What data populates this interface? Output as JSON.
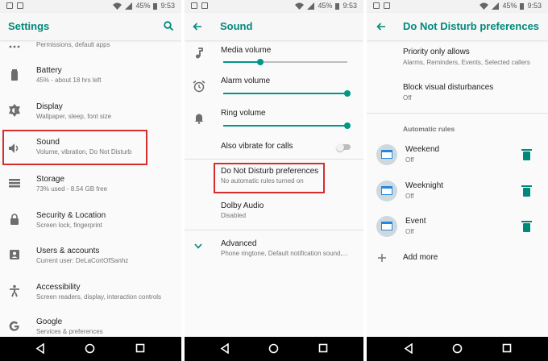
{
  "status": {
    "battery": "45%",
    "time": "9:53"
  },
  "settings": {
    "title": "Settings",
    "partial_top": "Permissions, default apps",
    "items": [
      {
        "title": "Battery",
        "subtitle": "45% - about 18 hrs left",
        "icon": "battery-icon"
      },
      {
        "title": "Display",
        "subtitle": "Wallpaper, sleep, font size",
        "icon": "brightness-icon"
      },
      {
        "title": "Sound",
        "subtitle": "Volume, vibration, Do Not Disturb",
        "icon": "volume-icon"
      },
      {
        "title": "Storage",
        "subtitle": "73% used - 8.54 GB free",
        "icon": "storage-icon"
      },
      {
        "title": "Security & Location",
        "subtitle": "Screen lock, fingerprint",
        "icon": "lock-icon"
      },
      {
        "title": "Users & accounts",
        "subtitle": "Current user: DeLaCortOfSanhz",
        "icon": "account-icon"
      },
      {
        "title": "Accessibility",
        "subtitle": "Screen readers, display, interaction controls",
        "icon": "accessibility-icon"
      },
      {
        "title": "Google",
        "subtitle": "Services & preferences",
        "icon": "google-icon"
      }
    ]
  },
  "sound": {
    "title": "Sound",
    "media_volume": "Media volume",
    "media_level": 0.3,
    "alarm_volume": "Alarm volume",
    "alarm_level": 1.0,
    "ring_volume": "Ring volume",
    "ring_level": 1.0,
    "vibrate": "Also vibrate for calls",
    "dnd_title": "Do Not Disturb preferences",
    "dnd_subtitle": "No automatic rules turned on",
    "dolby_title": "Dolby Audio",
    "dolby_subtitle": "Disabled",
    "advanced_title": "Advanced",
    "advanced_subtitle": "Phone ringtone, Default notification sound,..."
  },
  "dnd": {
    "title": "Do Not Disturb preferences",
    "priority_title": "Priority only allows",
    "priority_subtitle": "Alarms, Reminders, Events, Selected callers",
    "block_title": "Block visual disturbances",
    "block_subtitle": "Off",
    "rules_header": "Automatic rules",
    "rules": [
      {
        "name": "Weekend",
        "state": "Off"
      },
      {
        "name": "Weeknight",
        "state": "Off"
      },
      {
        "name": "Event",
        "state": "Off"
      }
    ],
    "add_more": "Add more"
  },
  "colors": {
    "accent": "#00897b",
    "highlight": "#d32f2f"
  }
}
